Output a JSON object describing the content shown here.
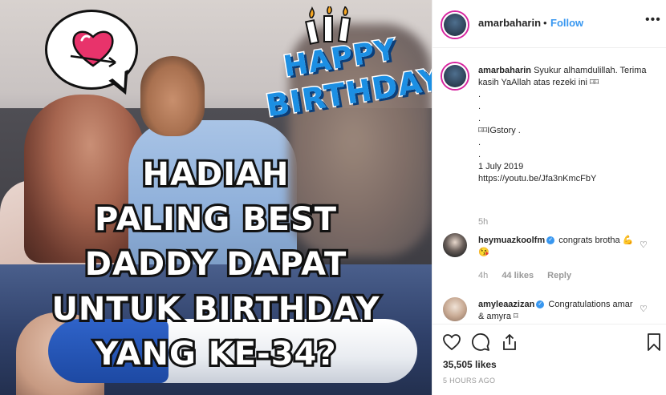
{
  "post": {
    "username": "amarbaharin",
    "separator": "•",
    "follow_label": "Follow",
    "more_label": "•••",
    "image_overlay": {
      "happy": "HAPPY",
      "birthday": "BIRTHDAY",
      "caption_lines": [
        "HADIAH",
        "PALING BEST",
        "DADDY DAPAT",
        "UNTUK BIRTHDAY",
        "YANG KE-34?"
      ]
    },
    "caption": {
      "username": "amarbaharin",
      "text": "Syukur alhamdulillah. Terima kasih YaAllah atas rezeki ini ⌑⌑\n.\n.\n.\n⌑⌑IGstory .\n.\n.\n1 July 2019\nhttps://youtu.be/Jfa3nKmcFbY",
      "age": "5h"
    },
    "comments": [
      {
        "username": "heymuazkoolfm",
        "verified": true,
        "text": "congrats brotha 💪😘",
        "age": "4h",
        "likes": "44 likes",
        "reply": "Reply",
        "avatar_color": "#2b2b2b"
      },
      {
        "username": "amyleaazizan",
        "verified": true,
        "text": "Congratulations amar & amyra ⌑",
        "avatar_color": "#b99a86"
      }
    ],
    "like_count": "35,505 likes",
    "timestamp": "5 HOURS AGO",
    "colors": {
      "link_blue": "#3897f0",
      "story_ring": "#d6249f",
      "text": "#262626",
      "muted": "#999999"
    }
  }
}
